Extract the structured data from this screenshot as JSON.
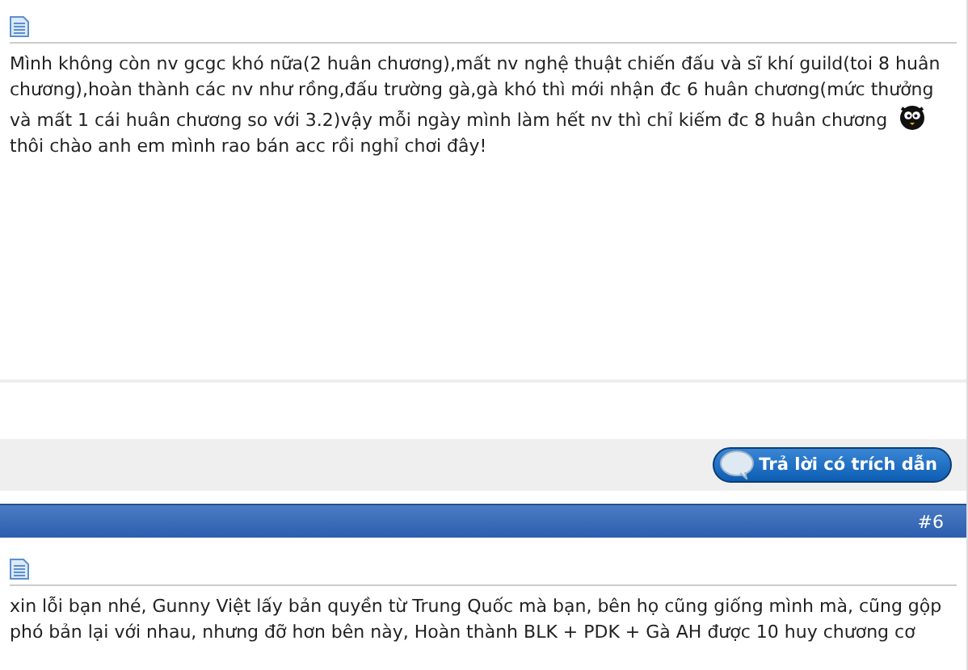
{
  "posts": [
    {
      "text": "Mình không còn nv gcgc khó nữa(2 huân chương),mất nv nghệ thuật chiến đấu và sĩ khí guild(toi 8 huân chương),hoàn thành các nv như rồng,đấu trường gà,gà khó thì mới nhận đc 6 huân chương(mức thưởng và mất 1 cái huân chương so với 3.2)vậy mỗi ngày mình làm hết nv thì chỉ kiếm đc 8 huân chương",
      "smiley": true,
      "text_after": "thôi chào anh em mình rao bán acc rồi nghỉ chơi đây!",
      "quote_button": "Trả lời có trích dẫn"
    },
    {
      "number": "#6",
      "text": "xin lỗi bạn nhé, Gunny Việt lấy bản quyền từ Trung Quốc mà bạn, bên họ cũng giống mình mà, cũng gộp phó bản lại với nhau, nhưng đỡ hơn bên này, Hoàn thành BLK + PDK + Gà AH được 10 huy chương cơ"
    }
  ]
}
